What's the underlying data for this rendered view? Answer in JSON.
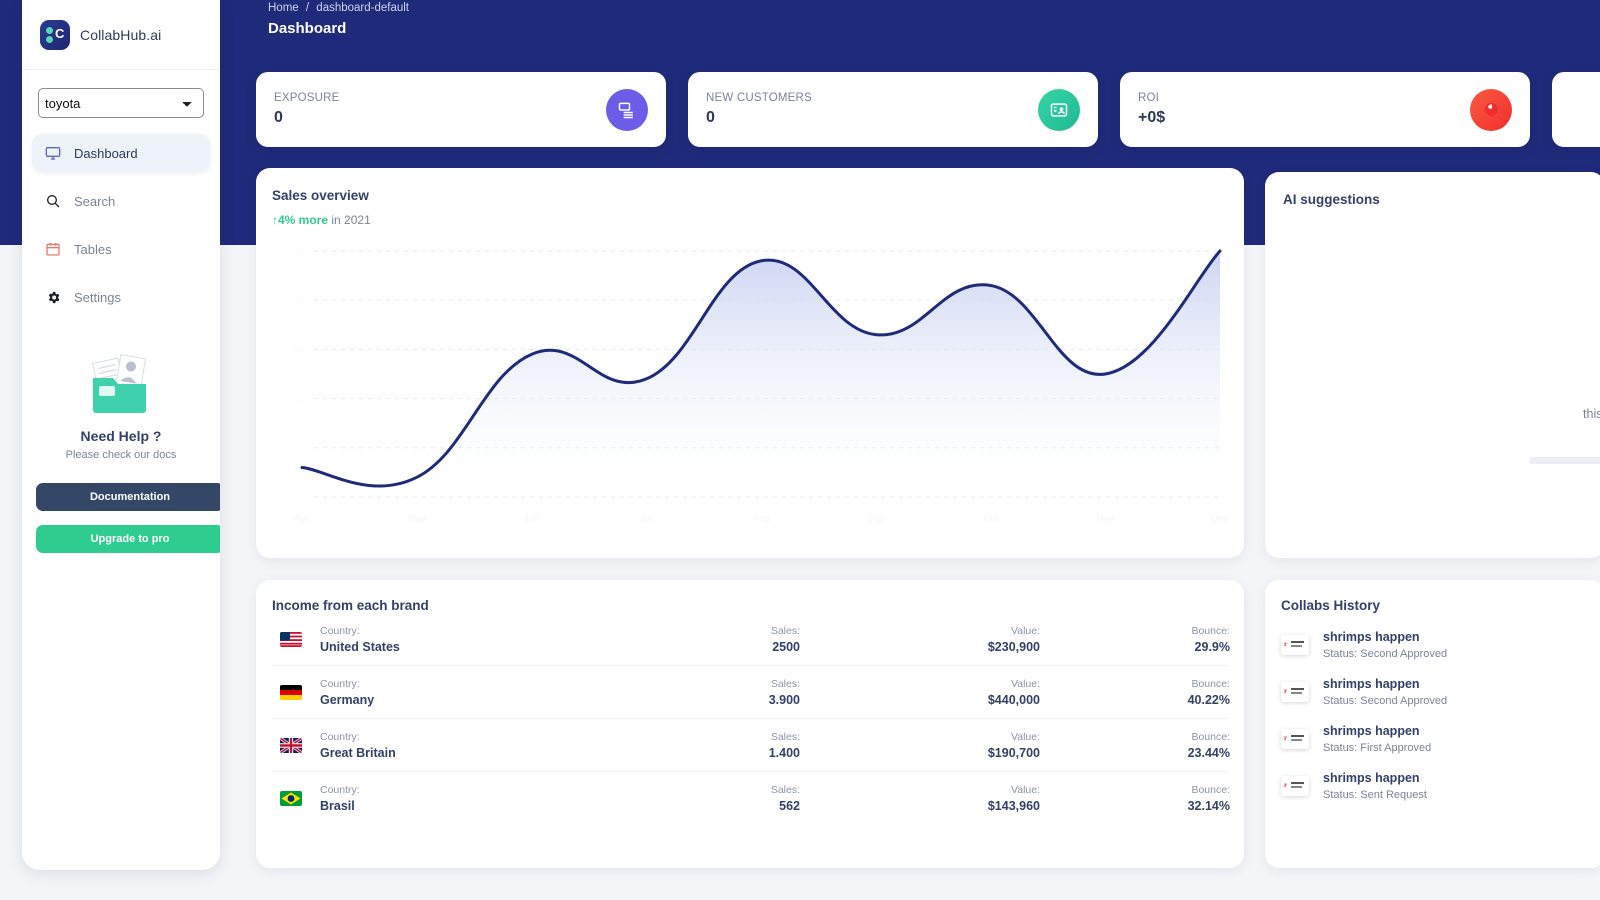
{
  "brand": {
    "name": "CollabHub.ai",
    "logo_icon": "collabhub-logo-icon"
  },
  "sidebar": {
    "account_select": {
      "value": "toyota",
      "options": [
        "toyota"
      ],
      "icon": "chevron-down-icon"
    },
    "items": [
      {
        "label": "Dashboard",
        "icon": "monitor-icon",
        "active": true
      },
      {
        "label": "Search",
        "icon": "search-icon",
        "active": false
      },
      {
        "label": "Tables",
        "icon": "calendar-icon",
        "active": false
      },
      {
        "label": "Settings",
        "icon": "gear-icon",
        "active": false
      }
    ],
    "help": {
      "image_icon": "documents-folder-icon",
      "title": "Need Help ?",
      "subtitle": "Please check our docs",
      "documentation_label": "Documentation",
      "upgrade_label": "Upgrade to pro"
    }
  },
  "topbar": {
    "breadcrumb_home": "Home",
    "breadcrumb_sep": "/",
    "breadcrumb_current": "dashboard-default",
    "page_title": "Dashboard"
  },
  "stats": [
    {
      "label": "EXPOSURE",
      "value": "0",
      "icon": "money-stack-icon",
      "color": "#6d5ce7"
    },
    {
      "label": "NEW CUSTOMERS",
      "value": "0",
      "icon": "contact-card-icon",
      "color": "#2ecc8f"
    },
    {
      "label": "ROI",
      "value": "+0$",
      "icon": "coin-icon",
      "color": "#f5413c"
    }
  ],
  "sales": {
    "title": "Sales overview",
    "delta_arrow": "↑",
    "delta": "4% more",
    "delta_period": "in 2021"
  },
  "chart_data": {
    "type": "area",
    "title": "Sales overview",
    "xlabel": "",
    "ylabel": "",
    "grid": true,
    "legend": false,
    "categories": [
      "Apr",
      "May",
      "Jun",
      "Jul",
      "Aug",
      "Sep",
      "Oct",
      "Nov",
      "Dec"
    ],
    "xtick_labels": [
      "Apr",
      "May",
      "Jun",
      "Jul",
      "Aug",
      "Sep",
      "Oct",
      "Nov",
      "Dec"
    ],
    "ytick_labels": [
      "0",
      "100",
      "200",
      "300",
      "400",
      "500"
    ],
    "ylim": [
      0,
      500
    ],
    "series": [
      {
        "name": "Sales",
        "values": [
          60,
          40,
          290,
          240,
          480,
          330,
          430,
          250,
          500
        ],
        "color": "#1f2a7a"
      }
    ]
  },
  "income": {
    "title": "Income from each brand",
    "columns": [
      "Country:",
      "Sales:",
      "Value:",
      "Bounce:"
    ],
    "rows": [
      {
        "flag": "flag-us-icon",
        "country_label": "Country:",
        "country": "United States",
        "sales_label": "Sales:",
        "sales": "2500",
        "value_label": "Value:",
        "value": "$230,900",
        "bounce_label": "Bounce:",
        "bounce": "29.9%"
      },
      {
        "flag": "flag-de-icon",
        "country_label": "Country:",
        "country": "Germany",
        "sales_label": "Sales:",
        "sales": "3.900",
        "value_label": "Value:",
        "value": "$440,000",
        "bounce_label": "Bounce:",
        "bounce": "40.22%"
      },
      {
        "flag": "flag-gb-icon",
        "country_label": "Country:",
        "country": "Great Britain",
        "sales_label": "Sales:",
        "sales": "1.400",
        "value_label": "Value:",
        "value": "$190,700",
        "bounce_label": "Bounce:",
        "bounce": "23.44%"
      },
      {
        "flag": "flag-br-icon",
        "country_label": "Country:",
        "country": "Brasil",
        "sales_label": "Sales:",
        "sales": "562",
        "value_label": "Value:",
        "value": "$143,960",
        "bounce_label": "Bounce:",
        "bounce": "32.14%"
      }
    ]
  },
  "ai": {
    "title": "AI suggestions",
    "clipped_text": "this is"
  },
  "collabs": {
    "title": "Collabs History",
    "items": [
      {
        "thumb": "document-thumb-icon",
        "name": "shrimps happen",
        "status": "Status: Second Approved"
      },
      {
        "thumb": "document-thumb-icon",
        "name": "shrimps happen",
        "status": "Status: Second Approved"
      },
      {
        "thumb": "document-thumb-icon",
        "name": "shrimps happen",
        "status": "Status: First Approved"
      },
      {
        "thumb": "document-thumb-icon",
        "name": "shrimps happen",
        "status": "Status: Sent Request"
      }
    ]
  },
  "theme": {
    "header_blue": "#1f2a7a",
    "page_bg": "#f4f5f9",
    "accent_green": "#2ecc8f",
    "text_dark": "#33406a",
    "text_muted": "#7b8399"
  }
}
